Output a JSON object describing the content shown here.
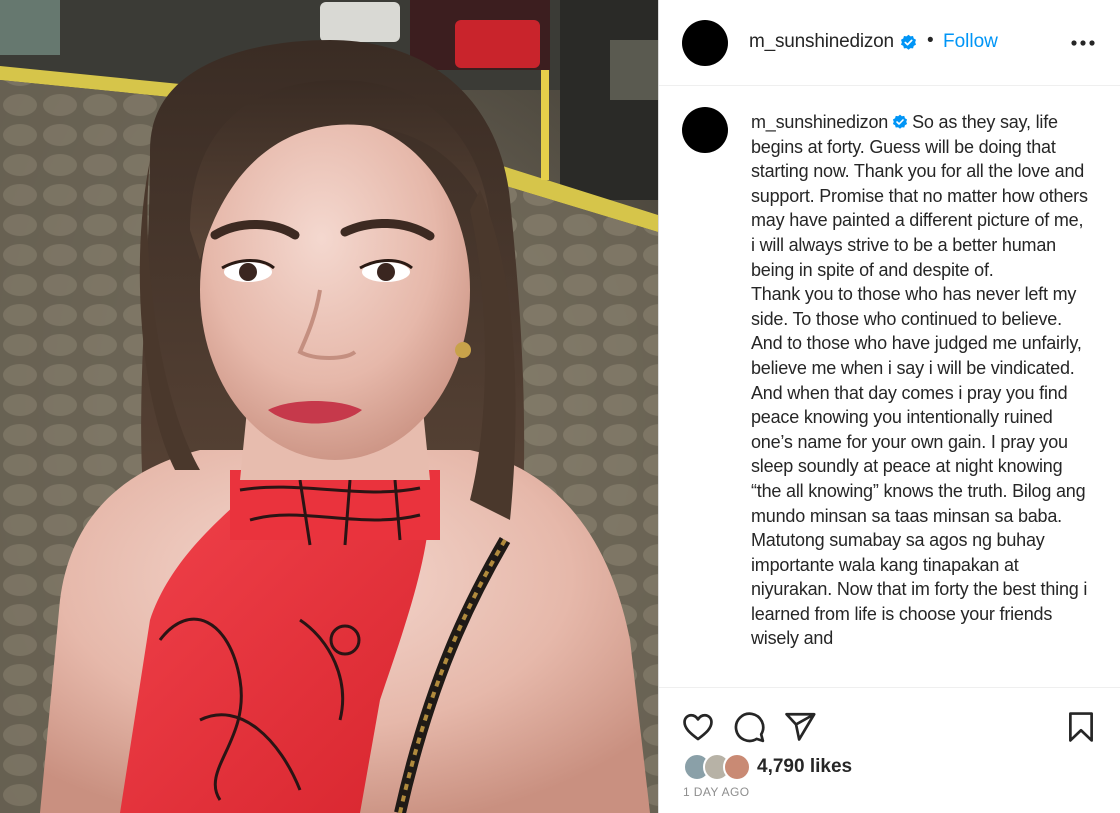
{
  "header": {
    "username": "m_sunshinedizon",
    "separator": "•",
    "follow_label": "Follow",
    "more_icon": "more-horizontal-icon"
  },
  "caption": {
    "username": "m_sunshinedizon",
    "text": "So as they say, life begins at forty. Guess will be doing that starting now. Thank you for all the love and support. Promise that no matter how others may have painted a different picture of me, i will always strive to be a better human being in spite of and despite of.",
    "text2": "Thank you to those who has never left my side. To those who continued to believe. And to those who have judged me unfairly, believe me when i say i will be vindicated. And when that day comes i pray you find peace knowing you intentionally ruined one’s name for your own gain. I pray you sleep soundly at peace at night knowing “the all knowing” knows the truth. Bilog ang mundo minsan sa taas minsan sa baba. Matutong sumabay sa agos ng buhay importante wala kang tinapakan at niyurakan. Now that im forty the best thing i learned from life is choose your friends wisely and"
  },
  "actions": {
    "like_icon": "heart-icon",
    "comment_icon": "comment-icon",
    "share_icon": "share-icon",
    "save_icon": "bookmark-icon"
  },
  "likes": "4,790 likes",
  "timestamp": "1 DAY AGO",
  "colors": {
    "accent": "#0095f6",
    "text": "#262626",
    "muted": "#8e8e8e",
    "verified": "#0095f6"
  }
}
